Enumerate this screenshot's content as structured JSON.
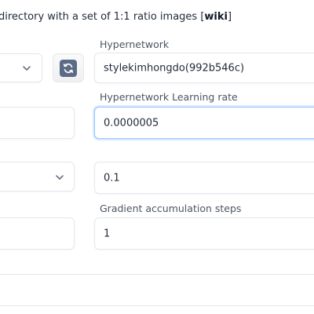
{
  "header": {
    "description_text": "directory with a set of 1:1 ratio images [",
    "wiki_link": "wiki",
    "description_end": "]"
  },
  "right_column": {
    "hypernetwork": {
      "label": "Hypernetwork",
      "value": "stylekimhongdo(992b546c)"
    },
    "learning_rate": {
      "label": "Hypernetwork Learning rate",
      "value": "0.0000005"
    },
    "third_field": {
      "value": "0.1"
    },
    "gradient_accumulation": {
      "label": "Gradient accumulation steps",
      "value": "1"
    }
  },
  "icons": {
    "refresh": "refresh-icon",
    "chevron": "chevron-down-icon"
  },
  "colors": {
    "focus_border": "#93c5fd",
    "refresh_icon_bg": "#5b6b86"
  }
}
